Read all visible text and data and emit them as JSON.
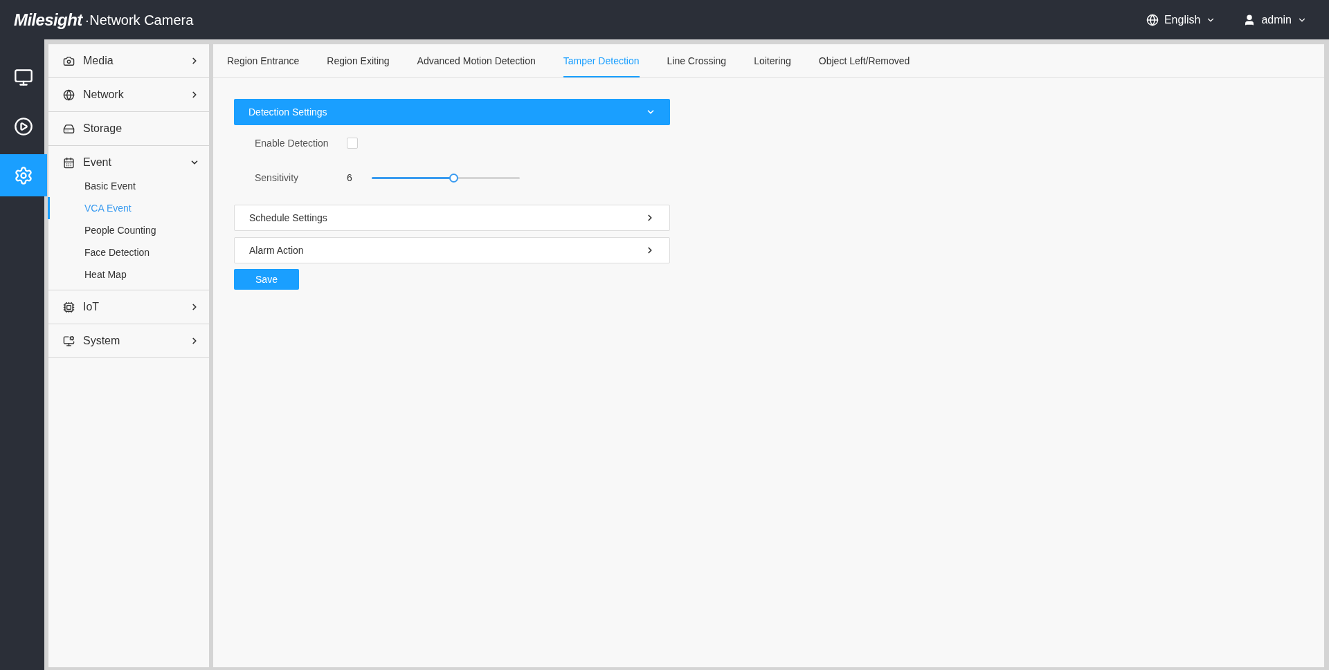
{
  "header": {
    "logo": "Milesight",
    "product": "·Network Camera",
    "language": "English",
    "user": "admin"
  },
  "rail": [
    {
      "kind": "live",
      "selected": false
    },
    {
      "kind": "playback",
      "selected": false
    },
    {
      "kind": "settings",
      "selected": true
    }
  ],
  "sidebar": {
    "items": [
      {
        "label": "Media",
        "kind": "media",
        "expanded": false
      },
      {
        "label": "Network",
        "kind": "network",
        "expanded": false
      },
      {
        "label": "Storage",
        "kind": "storage"
      },
      {
        "label": "Event",
        "kind": "event",
        "expanded": true,
        "children": [
          {
            "label": "Basic Event",
            "selected": false
          },
          {
            "label": "VCA Event",
            "selected": true
          },
          {
            "label": "People Counting",
            "selected": false
          },
          {
            "label": "Face Detection",
            "selected": false
          },
          {
            "label": "Heat Map",
            "selected": false
          }
        ]
      },
      {
        "label": "IoT",
        "kind": "iot",
        "expanded": false
      },
      {
        "label": "System",
        "kind": "system",
        "expanded": false
      }
    ]
  },
  "tabs": [
    {
      "label": "Region Entrance",
      "selected": false
    },
    {
      "label": "Region Exiting",
      "selected": false
    },
    {
      "label": "Advanced Motion Detection",
      "selected": false
    },
    {
      "label": "Tamper Detection",
      "selected": true
    },
    {
      "label": "Line Crossing",
      "selected": false
    },
    {
      "label": "Loitering",
      "selected": false
    },
    {
      "label": "Object Left/Removed",
      "selected": false
    }
  ],
  "sections": [
    {
      "title": "Detection Settings",
      "expanded": true,
      "fields": [
        {
          "kind": "checkbox",
          "label": "Enable Detection",
          "checked": false
        },
        {
          "kind": "slider",
          "label": "Sensitivity",
          "value": "6",
          "level": 0.55
        }
      ]
    },
    {
      "title": "Schedule Settings",
      "expanded": false
    },
    {
      "title": "Alarm Action",
      "expanded": false
    }
  ],
  "save_button": "Save"
}
